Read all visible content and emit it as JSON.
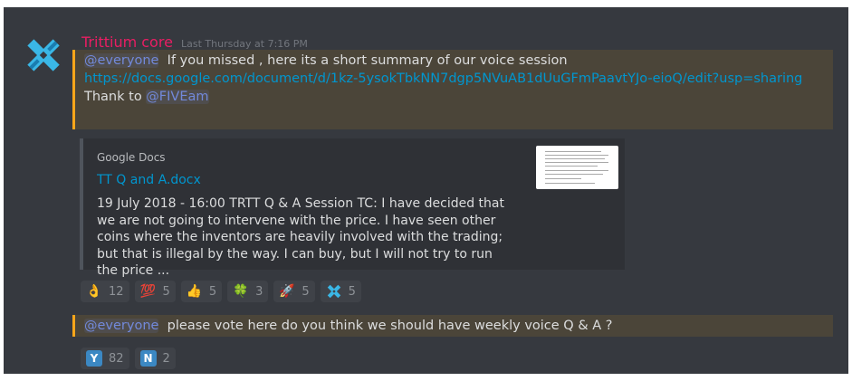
{
  "message1": {
    "author": "Trittium core",
    "timestamp": "Last Thursday at 7:16 PM",
    "mention": "@everyone",
    "text": "If you missed , here  its a short summary of  our voice session",
    "link": "https://docs.google.com/document/d/1kz-5ysokTbkNN7dgp5NVuAB1dUuGFmPaavtYJo-eioQ/edit?usp=sharing",
    "thanks_prefix": "Thank to ",
    "thanks_mention": "@FIVEam"
  },
  "embed": {
    "provider": "Google Docs",
    "title": "TT Q and A.docx",
    "description": "19 July 2018 - 16:00 TRTT Q & A Session TC: I have decided that we are not going to intervene with the price. I have seen other coins where the inventors are heavily involved with the trading; but that is illegal by the way. I can buy, but I will not try to run the price ..."
  },
  "reactions1": [
    {
      "icon": "ok-hand-icon",
      "glyph": "👌",
      "count": "12"
    },
    {
      "icon": "hundred-points-icon",
      "glyph": "💯",
      "count": "5"
    },
    {
      "icon": "thumbs-up-icon",
      "glyph": "👍",
      "count": "5"
    },
    {
      "icon": "four-leaf-clover-icon",
      "glyph": "🍀",
      "count": "3"
    },
    {
      "icon": "rocket-icon",
      "glyph": "🚀",
      "count": "5"
    },
    {
      "icon": "trittium-logo-icon",
      "glyph": "",
      "count": "5"
    }
  ],
  "message2": {
    "mention": "@everyone",
    "text": "please vote here do you think we should have weekly voice Q & A ?"
  },
  "reactions2": [
    {
      "icon": "regional-indicator-y-icon",
      "letter": "Y",
      "count": "82"
    },
    {
      "icon": "regional-indicator-n-icon",
      "letter": "N",
      "count": "2"
    }
  ],
  "colors": {
    "background": "#36393f",
    "username": "#e91e63",
    "mention": "#7289da",
    "link": "#0096cf",
    "highlight_bg": "#4b4539",
    "highlight_border": "#faa61a",
    "embed_bg": "#2f3136"
  }
}
